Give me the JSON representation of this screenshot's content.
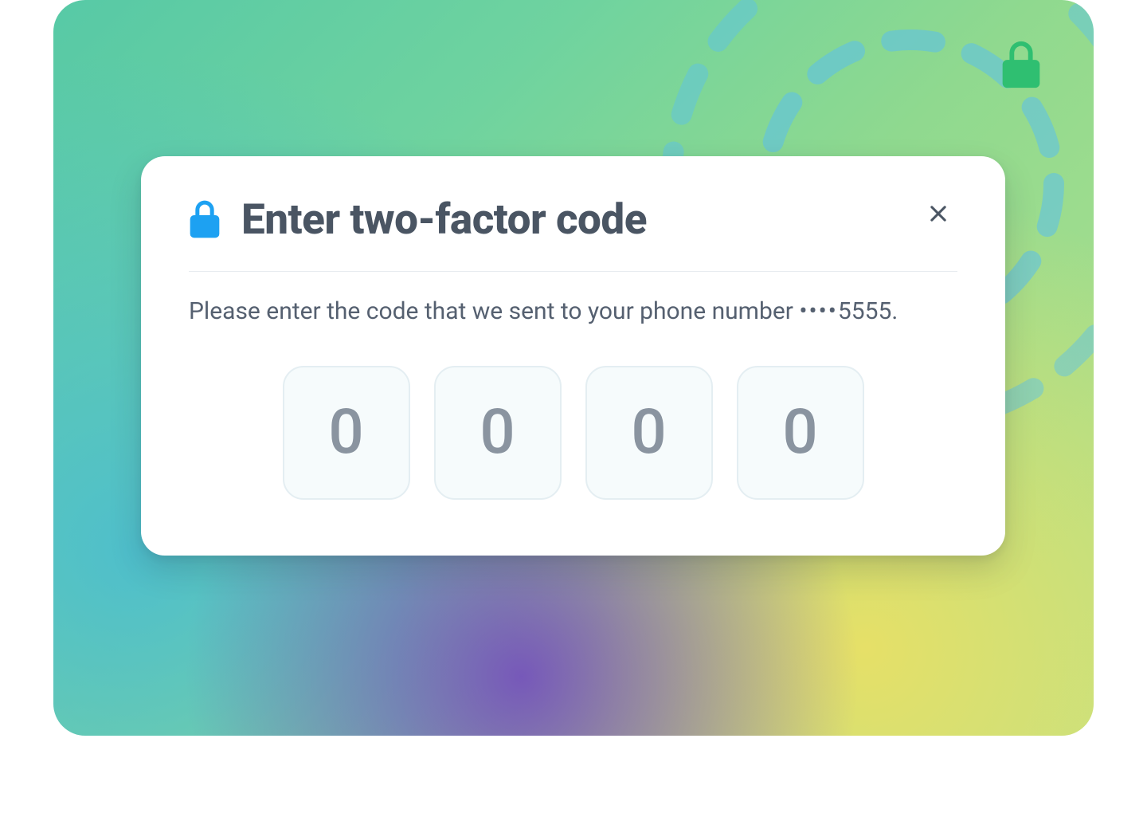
{
  "modal": {
    "title": "Enter two-factor code",
    "instructions_prefix": "Please enter the code that we sent to your phone number ",
    "mask": "••••",
    "last_digits": "5555",
    "period": ".",
    "code_placeholder": "0",
    "code_length": 4
  },
  "icons": {
    "header_lock": "lock-icon",
    "corner_lock": "lock-icon",
    "close": "close-icon"
  },
  "colors": {
    "accent_blue": "#1da1f2",
    "accent_green": "#2fbf71",
    "text_heading": "#4a5563",
    "text_body": "#556070",
    "cell_border": "#e4eef2",
    "cell_bg": "#f6fbfc"
  }
}
